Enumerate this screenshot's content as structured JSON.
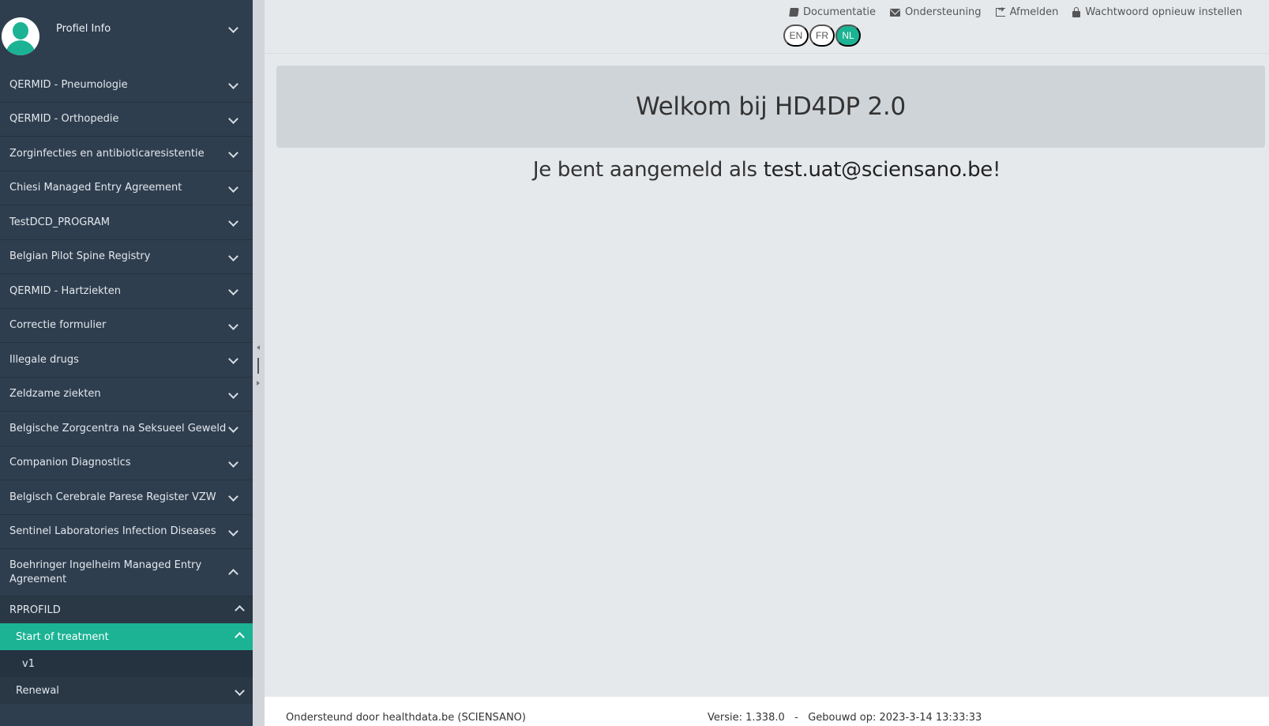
{
  "sidebar": {
    "profile_label": "Profiel Info",
    "items": [
      {
        "label": "QERMID - Pneumologie"
      },
      {
        "label": "QERMID - Orthopedie"
      },
      {
        "label": "Zorginfecties en antibioticaresistentie"
      },
      {
        "label": "Chiesi Managed Entry Agreement"
      },
      {
        "label": "TestDCD_PROGRAM"
      },
      {
        "label": "Belgian Pilot Spine Registry"
      },
      {
        "label": "QERMID - Hartziekten"
      },
      {
        "label": "Correctie formulier"
      },
      {
        "label": "Illegale drugs"
      },
      {
        "label": "Zeldzame ziekten"
      },
      {
        "label": "Belgische Zorgcentra na Seksueel Geweld"
      },
      {
        "label": "Companion Diagnostics"
      },
      {
        "label": "Belgisch Cerebrale Parese Register VZW"
      },
      {
        "label": "Sentinel Laboratories Infection Diseases"
      },
      {
        "label": "Boehringer Ingelheim Managed Entry Agreement"
      }
    ],
    "expanded": {
      "group": "RPROFILD",
      "active": "Start of treatment",
      "version": "v1",
      "next": "Renewal"
    }
  },
  "header": {
    "links": [
      {
        "label": "Documentatie",
        "icon": "book-icon"
      },
      {
        "label": "Ondersteuning",
        "icon": "envelope-icon"
      },
      {
        "label": "Afmelden",
        "icon": "logout-icon"
      },
      {
        "label": "Wachtwoord opnieuw instellen",
        "icon": "lock-icon"
      }
    ],
    "languages": [
      "EN",
      "FR",
      "NL"
    ],
    "active_language": "NL"
  },
  "main": {
    "welcome_title": "Welkom bij HD4DP 2.0",
    "logged_in_prefix": "Je bent aangemeld als ",
    "email": "test.uat@sciensano.be",
    "logged_in_suffix": "!"
  },
  "footer": {
    "supported_by": "Ondersteund door healthdata.be (SCIENSANO)",
    "version": "Versie: 1.338.0   -   Gebouwd op: 2023-3-14 13:33:33"
  },
  "colors": {
    "accent": "#1bb394",
    "sidebar": "#2f3e4e",
    "background": "#e6e9ec"
  }
}
